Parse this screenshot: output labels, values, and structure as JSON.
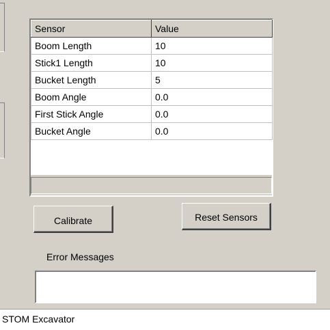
{
  "grid": {
    "columns": [
      "Sensor",
      "Value"
    ],
    "rows": [
      {
        "sensor": "Boom Length",
        "value": "10"
      },
      {
        "sensor": "Stick1 Length",
        "value": "10"
      },
      {
        "sensor": "Bucket Length",
        "value": "5"
      },
      {
        "sensor": "Boom Angle",
        "value": "0.0"
      },
      {
        "sensor": "First Stick Angle",
        "value": "0.0"
      },
      {
        "sensor": "Bucket Angle",
        "value": "0.0"
      }
    ]
  },
  "buttons": {
    "calibrate": "Calibrate",
    "reset_sensors": "Reset Sensors"
  },
  "errors": {
    "label": "Error Messages",
    "text": ""
  },
  "status_bar": {
    "text": "STOM Excavator"
  },
  "colors": {
    "window_face": "#d4d0c8",
    "field_bg": "#ffffff"
  }
}
